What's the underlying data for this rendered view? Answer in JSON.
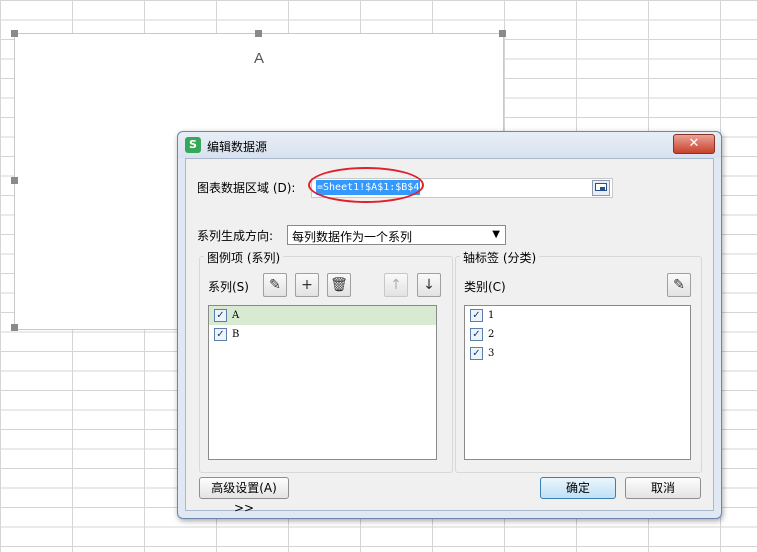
{
  "chart": {
    "title": "A"
  },
  "dialog": {
    "title": "编辑数据源",
    "app_icon": "S",
    "close_glyph": "✕",
    "range_label": "图表数据区域 (D):",
    "range_value": "=Sheet1!$A$1:$B$4",
    "direction_label": "系列生成方向:",
    "direction_value": "每列数据作为一个系列",
    "series_group": {
      "title": "图例项 (系列)",
      "label": "系列(S)",
      "items": [
        {
          "name": "A",
          "checked": true,
          "selected": true
        },
        {
          "name": "B",
          "checked": true,
          "selected": false
        }
      ]
    },
    "category_group": {
      "title": "轴标签 (分类)",
      "label": "类别(C)",
      "items": [
        {
          "name": "1",
          "checked": true
        },
        {
          "name": "2",
          "checked": true
        },
        {
          "name": "3",
          "checked": true
        }
      ]
    },
    "advanced_label": "高级设置(A) >>",
    "ok_label": "确定",
    "cancel_label": "取消"
  },
  "icons": {
    "edit": "pencil-icon",
    "add": "plus-icon",
    "delete": "trash-icon",
    "up": "arrow-up-icon",
    "down": "arrow-down-icon",
    "range_select": "range-select-icon"
  },
  "colors": {
    "highlight": "#3399ff",
    "annotation": "#e0202a",
    "selected_row": "#d9ead3",
    "close": "#c9412b"
  }
}
